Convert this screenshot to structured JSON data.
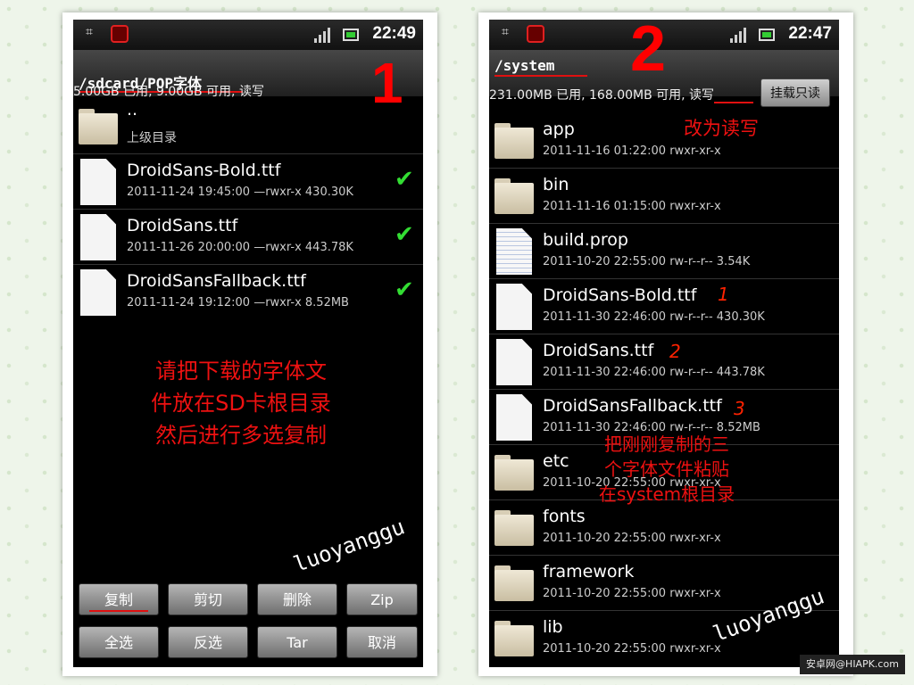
{
  "left": {
    "status_time": "22:49",
    "path": "/sdcard/POP字体",
    "storage": "5.00GB 已用, 9.00GB 可用, 读写",
    "parent": {
      "name": "..",
      "label": "上级目录"
    },
    "files": [
      {
        "name": "DroidSans-Bold.ttf",
        "meta": "2011-11-24 19:45:00 —rwxr-x 430.30K"
      },
      {
        "name": "DroidSans.ttf",
        "meta": "2011-11-26 20:00:00 —rwxr-x 443.78K"
      },
      {
        "name": "DroidSansFallback.ttf",
        "meta": "2011-11-24 19:12:00 —rwxr-x 8.52MB"
      }
    ],
    "annotation": [
      "请把下载的字体文",
      "件放在SD卡根目录",
      "然后进行多选复制"
    ],
    "step_number": "1",
    "watermark": "luoyanggu",
    "buttons": [
      "复制",
      "剪切",
      "删除",
      "Zip",
      "全选",
      "反选",
      "Tar",
      "取消"
    ]
  },
  "right": {
    "status_time": "22:47",
    "path": "/system",
    "storage": "231.00MB 已用, 168.00MB 可用, 读写",
    "mount_button": "挂载只读",
    "annotation_top": "改为读写",
    "step_number": "2",
    "items": [
      {
        "name": "app",
        "meta": "2011-11-16 01:22:00 rwxr-xr-x",
        "icon": "folder"
      },
      {
        "name": "bin",
        "meta": "2011-11-16 01:15:00 rwxr-xr-x",
        "icon": "folder"
      },
      {
        "name": "build.prop",
        "meta": "2011-10-20 22:55:00 rw-r--r-- 3.54K",
        "icon": "prop"
      },
      {
        "name": "DroidSans-Bold.ttf",
        "meta": "2011-11-30 22:46:00 rw-r--r-- 430.30K",
        "icon": "file",
        "tag": "1"
      },
      {
        "name": "DroidSans.ttf",
        "meta": "2011-11-30 22:46:00 rw-r--r-- 443.78K",
        "icon": "file",
        "tag": "2"
      },
      {
        "name": "DroidSansFallback.ttf",
        "meta": "2011-11-30 22:46:00 rw-r--r-- 8.52MB",
        "icon": "file",
        "tag": "3"
      },
      {
        "name": "etc",
        "meta": "2011-10-20 22:55:00 rwxr-xr-x",
        "icon": "folder"
      },
      {
        "name": "fonts",
        "meta": "2011-10-20 22:55:00 rwxr-xr-x",
        "icon": "folder"
      },
      {
        "name": "framework",
        "meta": "2011-10-20 22:55:00 rwxr-xr-x",
        "icon": "folder"
      },
      {
        "name": "lib",
        "meta": "2011-10-20 22:55:00 rwxr-xr-x",
        "icon": "folder"
      }
    ],
    "annotation_mid": [
      "把刚刚复制的三",
      "个字体文件粘贴",
      "在system根目录"
    ],
    "watermark": "luoyanggu"
  },
  "source_badge": "安卓网@HIAPK.com",
  "colors": {
    "annotation": "#ee1111",
    "check": "#33dd33",
    "background": "#eef5ea"
  }
}
